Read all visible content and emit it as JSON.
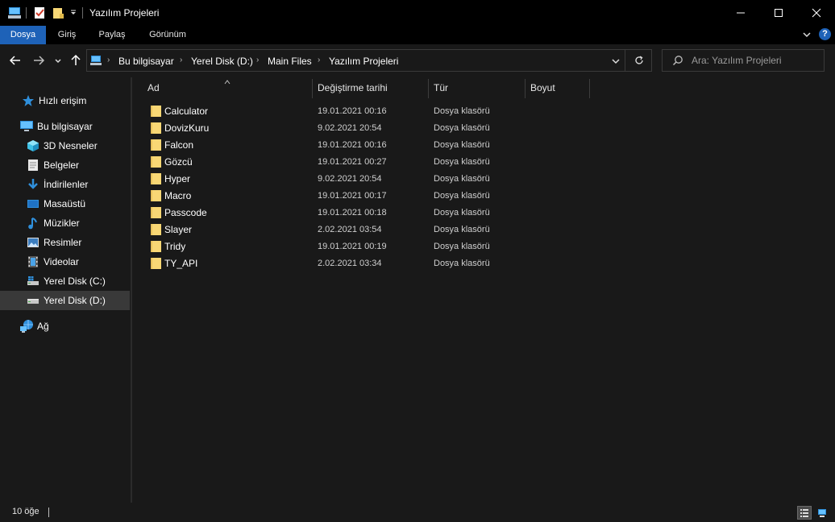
{
  "window": {
    "title": "Yazılım Projeleri"
  },
  "ribbon": {
    "tabs": [
      "Dosya",
      "Giriş",
      "Paylaş",
      "Görünüm"
    ]
  },
  "address": {
    "breadcrumbs": [
      "Bu bilgisayar",
      "Yerel Disk (D:)",
      "Main Files",
      "Yazılım Projeleri"
    ]
  },
  "search": {
    "placeholder": "Ara: Yazılım Projeleri"
  },
  "sidebar": {
    "quick_access": "Hızlı erişim",
    "this_pc": "Bu bilgisayar",
    "items": [
      {
        "label": "3D Nesneler",
        "icon": "cube-icon"
      },
      {
        "label": "Belgeler",
        "icon": "document-icon"
      },
      {
        "label": "İndirilenler",
        "icon": "download-icon"
      },
      {
        "label": "Masaüstü",
        "icon": "desktop-icon"
      },
      {
        "label": "Müzikler",
        "icon": "music-note-icon"
      },
      {
        "label": "Resimler",
        "icon": "picture-icon"
      },
      {
        "label": "Videolar",
        "icon": "film-icon"
      },
      {
        "label": "Yerel Disk (C:)",
        "icon": "drive-windows-icon"
      },
      {
        "label": "Yerel Disk (D:)",
        "icon": "drive-icon"
      }
    ],
    "network": "Ağ"
  },
  "columns": [
    "Ad",
    "Değiştirme tarihi",
    "Tür",
    "Boyut"
  ],
  "files": [
    {
      "name": "Calculator",
      "date": "19.01.2021 00:16",
      "type": "Dosya klasörü"
    },
    {
      "name": "DovizKuru",
      "date": "9.02.2021 20:54",
      "type": "Dosya klasörü"
    },
    {
      "name": "Falcon",
      "date": "19.01.2021 00:16",
      "type": "Dosya klasörü"
    },
    {
      "name": "Gözcü",
      "date": "19.01.2021 00:27",
      "type": "Dosya klasörü"
    },
    {
      "name": "Hyper",
      "date": "9.02.2021 20:54",
      "type": "Dosya klasörü"
    },
    {
      "name": "Macro",
      "date": "19.01.2021 00:17",
      "type": "Dosya klasörü"
    },
    {
      "name": "Passcode",
      "date": "19.01.2021 00:18",
      "type": "Dosya klasörü"
    },
    {
      "name": "Slayer",
      "date": "2.02.2021 03:54",
      "type": "Dosya klasörü"
    },
    {
      "name": "Tridy",
      "date": "19.01.2021 00:19",
      "type": "Dosya klasörü"
    },
    {
      "name": "TY_API",
      "date": "2.02.2021 03:34",
      "type": "Dosya klasörü"
    }
  ],
  "status": {
    "count": "10 öğe"
  },
  "colors": {
    "accent": "#1e62b8",
    "folder": "#f8d775",
    "background": "#191919"
  }
}
